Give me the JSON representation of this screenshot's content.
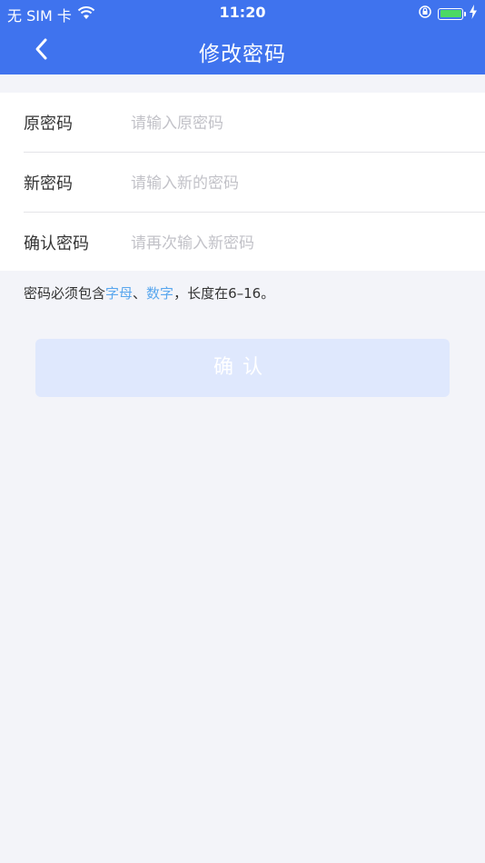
{
  "status_bar": {
    "carrier": "无 SIM 卡",
    "time": "11:20"
  },
  "nav": {
    "title": "修改密码"
  },
  "form": {
    "fields": [
      {
        "label": "原密码",
        "placeholder": "请输入原密码"
      },
      {
        "label": "新密码",
        "placeholder": "请输入新的密码"
      },
      {
        "label": "确认密码",
        "placeholder": "请再次输入新密码"
      }
    ]
  },
  "hint": {
    "prefix": "密码必须包含",
    "highlight1": "字母",
    "sep": "、",
    "highlight2": "数字",
    "suffix": "，长度在6–16。"
  },
  "confirm_button": {
    "label": "确认"
  },
  "colors": {
    "header": "#3f73ee",
    "background": "#f3f4f9",
    "highlight": "#5aa7ee",
    "button_disabled": "#dfe8fd"
  }
}
